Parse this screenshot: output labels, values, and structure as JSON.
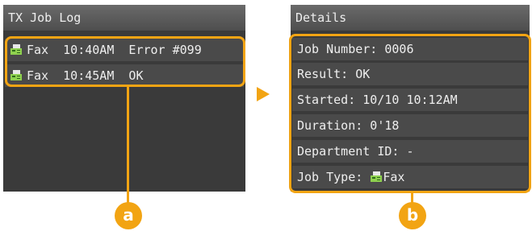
{
  "tx_job_log": {
    "title": "TX Job Log",
    "entries": [
      {
        "icon": "fax-icon",
        "text": "Fax  10:40AM  Error #099"
      },
      {
        "icon": "fax-icon",
        "text": "Fax  10:45AM  OK"
      }
    ]
  },
  "details": {
    "title": "Details",
    "rows": [
      {
        "text": "Job Number: 0006"
      },
      {
        "text": "Result: OK"
      },
      {
        "text": "Started: 10/10 10:12AM"
      },
      {
        "text": "Duration: 0'18"
      },
      {
        "text": "Department ID: -"
      },
      {
        "label": "Job Type: ",
        "icon": "fax-icon",
        "value": "Fax"
      }
    ]
  },
  "callouts": {
    "a": "a",
    "b": "b"
  },
  "colors": {
    "accent": "#f2a413",
    "screen_bg": "#3a3a3a",
    "row_bg": "#4a4a4a",
    "text": "#eeeeee"
  }
}
